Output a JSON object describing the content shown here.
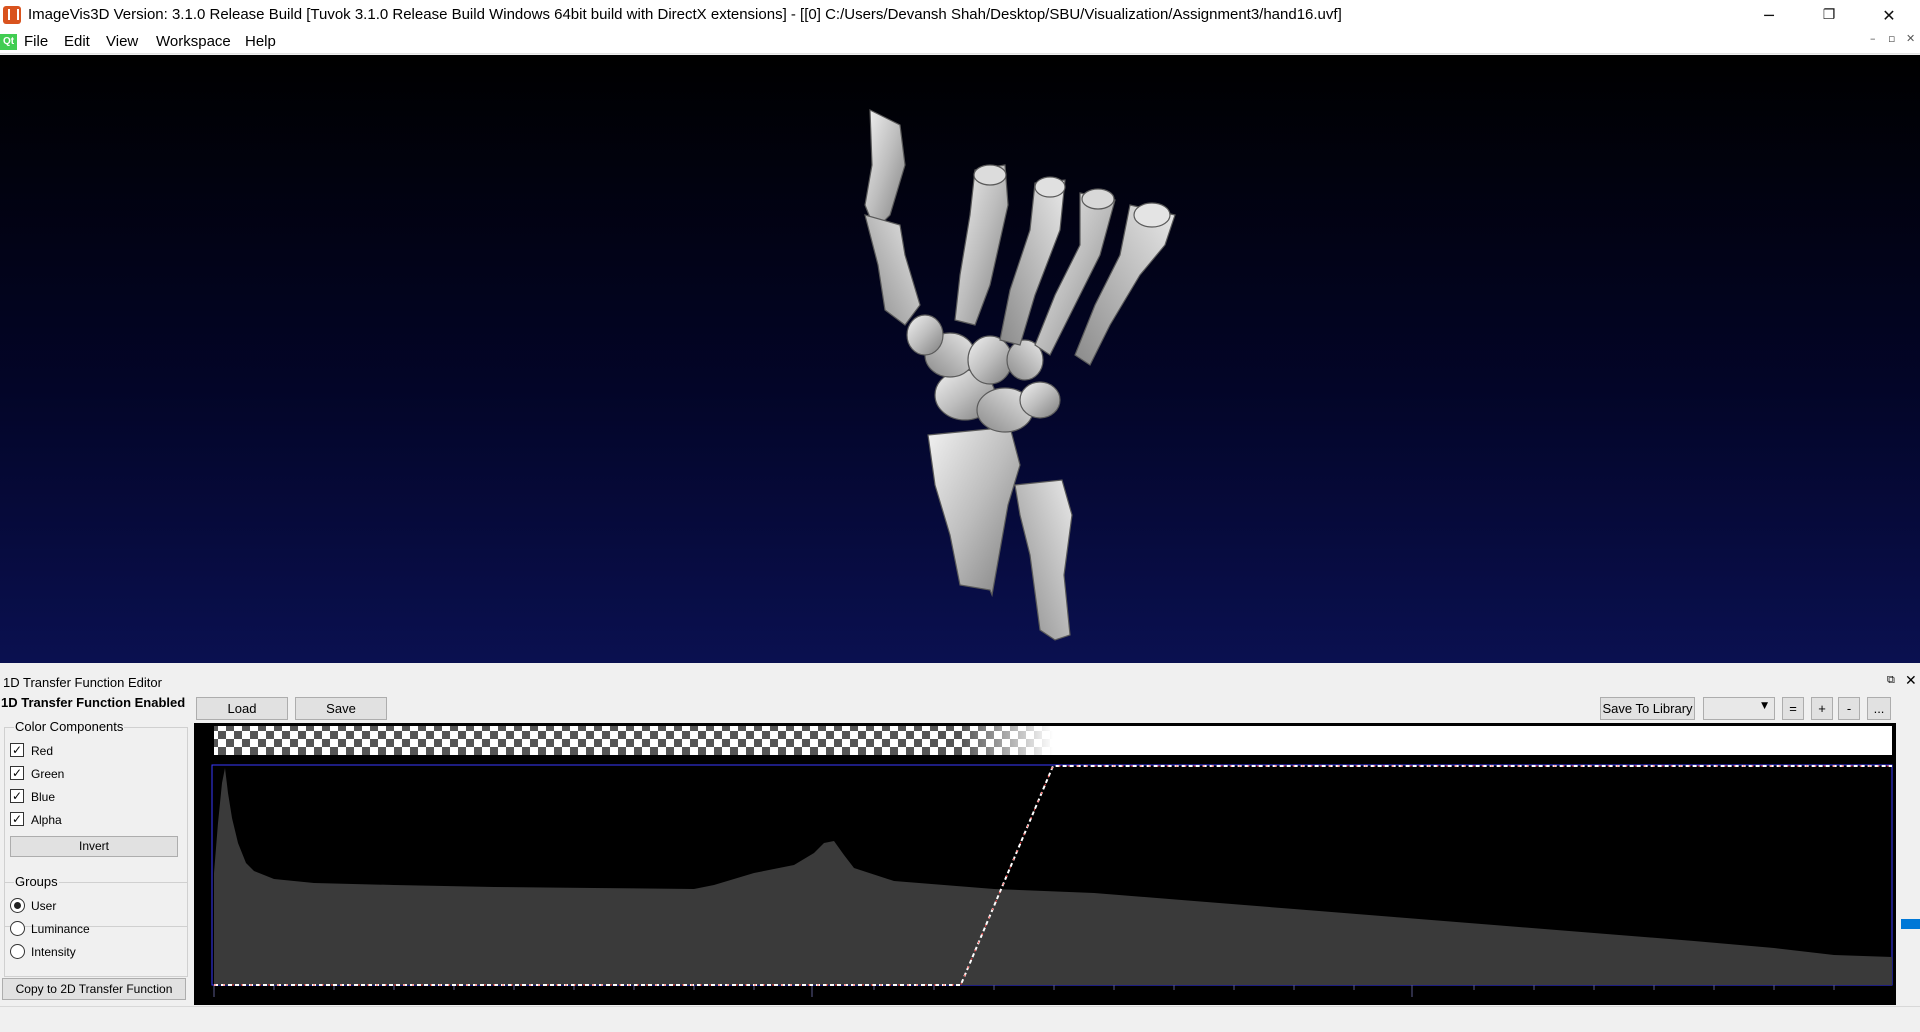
{
  "window": {
    "title": "ImageVis3D Version: 3.1.0 Release Build [Tuvok 3.1.0 Release Build Windows 64bit build with DirectX extensions] - [[0] C:/Users/Devansh Shah/Desktop/SBU/Visualization/Assignment3/hand16.uvf]",
    "minimize": "─",
    "restore": "❐",
    "close": "✕"
  },
  "menubar": {
    "qt_logo": "Qt",
    "items": [
      "File",
      "Edit",
      "View",
      "Workspace",
      "Help"
    ],
    "mdi_minimize": "–",
    "mdi_restore": "▫",
    "mdi_close": "✕"
  },
  "dock": {
    "title": "1D Transfer Function Editor",
    "float_icon": "⧉",
    "close_icon": "✕",
    "enabled_label": "1D Transfer Function Enabled",
    "load": "Load",
    "save": "Save",
    "save_to_library": "Save To Library",
    "library_value": "",
    "eq_btn": "=",
    "plus_btn": "+",
    "minus_btn": "-",
    "more_btn": "...",
    "color_components": {
      "title": "Color Components",
      "items": [
        {
          "label": "Red",
          "checked": true
        },
        {
          "label": "Green",
          "checked": true
        },
        {
          "label": "Blue",
          "checked": true
        },
        {
          "label": "Alpha",
          "checked": true
        }
      ],
      "invert": "Invert"
    },
    "groups": {
      "title": "Groups",
      "items": [
        {
          "label": "User",
          "selected": true
        },
        {
          "label": "Luminance",
          "selected": false
        },
        {
          "label": "Intensity",
          "selected": false
        }
      ]
    },
    "copy_2d": "Copy to 2D Transfer Function"
  },
  "transfer_function": {
    "ramp_start": 0.445,
    "ramp_end": 0.5,
    "opacity_min": 0,
    "opacity_max": 1
  },
  "colors": {
    "viewport_top": "#000000",
    "viewport_bottom": "#0a1050",
    "histogram": "#3a3a3a",
    "tf_curve": "#ffffff",
    "tf_frame": "#3a3aff",
    "scroll_thumb": "#0078d7"
  }
}
